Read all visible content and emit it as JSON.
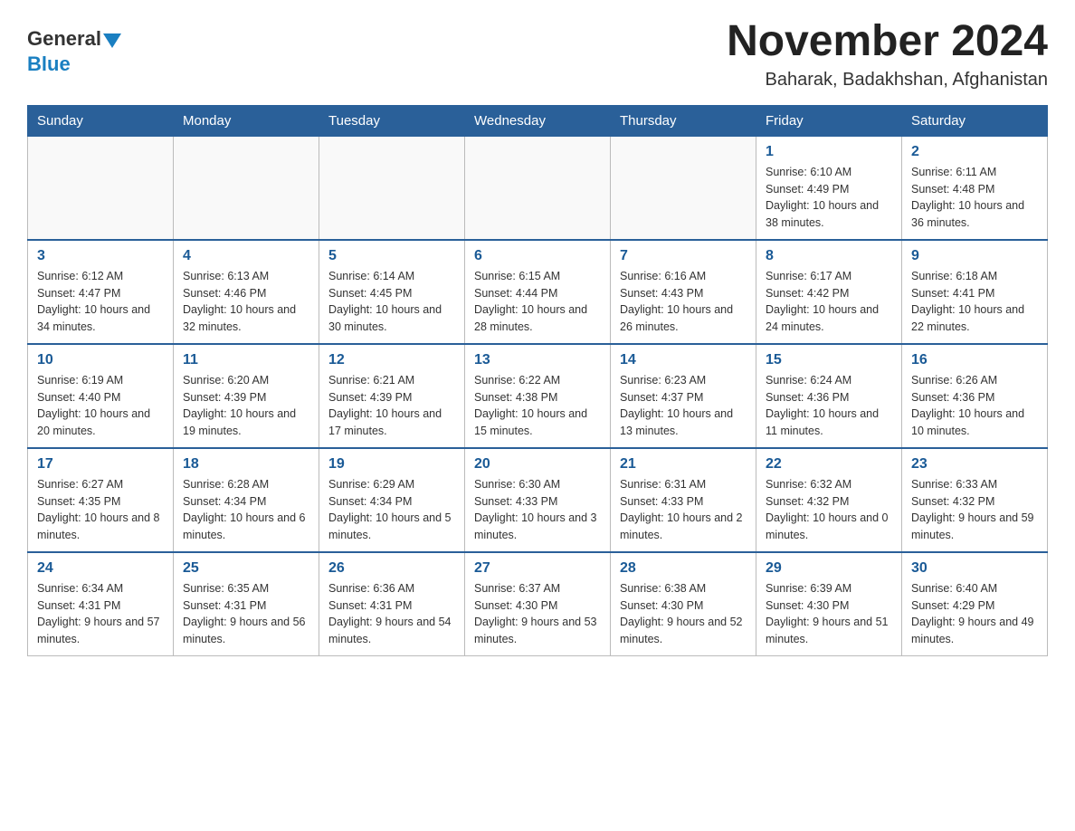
{
  "header": {
    "logo_general": "General",
    "logo_blue": "Blue",
    "month_title": "November 2024",
    "location": "Baharak, Badakhshan, Afghanistan"
  },
  "days_of_week": [
    "Sunday",
    "Monday",
    "Tuesday",
    "Wednesday",
    "Thursday",
    "Friday",
    "Saturday"
  ],
  "weeks": [
    [
      {
        "day": "",
        "sunrise": "",
        "sunset": "",
        "daylight": ""
      },
      {
        "day": "",
        "sunrise": "",
        "sunset": "",
        "daylight": ""
      },
      {
        "day": "",
        "sunrise": "",
        "sunset": "",
        "daylight": ""
      },
      {
        "day": "",
        "sunrise": "",
        "sunset": "",
        "daylight": ""
      },
      {
        "day": "",
        "sunrise": "",
        "sunset": "",
        "daylight": ""
      },
      {
        "day": "1",
        "sunrise": "Sunrise: 6:10 AM",
        "sunset": "Sunset: 4:49 PM",
        "daylight": "Daylight: 10 hours and 38 minutes."
      },
      {
        "day": "2",
        "sunrise": "Sunrise: 6:11 AM",
        "sunset": "Sunset: 4:48 PM",
        "daylight": "Daylight: 10 hours and 36 minutes."
      }
    ],
    [
      {
        "day": "3",
        "sunrise": "Sunrise: 6:12 AM",
        "sunset": "Sunset: 4:47 PM",
        "daylight": "Daylight: 10 hours and 34 minutes."
      },
      {
        "day": "4",
        "sunrise": "Sunrise: 6:13 AM",
        "sunset": "Sunset: 4:46 PM",
        "daylight": "Daylight: 10 hours and 32 minutes."
      },
      {
        "day": "5",
        "sunrise": "Sunrise: 6:14 AM",
        "sunset": "Sunset: 4:45 PM",
        "daylight": "Daylight: 10 hours and 30 minutes."
      },
      {
        "day": "6",
        "sunrise": "Sunrise: 6:15 AM",
        "sunset": "Sunset: 4:44 PM",
        "daylight": "Daylight: 10 hours and 28 minutes."
      },
      {
        "day": "7",
        "sunrise": "Sunrise: 6:16 AM",
        "sunset": "Sunset: 4:43 PM",
        "daylight": "Daylight: 10 hours and 26 minutes."
      },
      {
        "day": "8",
        "sunrise": "Sunrise: 6:17 AM",
        "sunset": "Sunset: 4:42 PM",
        "daylight": "Daylight: 10 hours and 24 minutes."
      },
      {
        "day": "9",
        "sunrise": "Sunrise: 6:18 AM",
        "sunset": "Sunset: 4:41 PM",
        "daylight": "Daylight: 10 hours and 22 minutes."
      }
    ],
    [
      {
        "day": "10",
        "sunrise": "Sunrise: 6:19 AM",
        "sunset": "Sunset: 4:40 PM",
        "daylight": "Daylight: 10 hours and 20 minutes."
      },
      {
        "day": "11",
        "sunrise": "Sunrise: 6:20 AM",
        "sunset": "Sunset: 4:39 PM",
        "daylight": "Daylight: 10 hours and 19 minutes."
      },
      {
        "day": "12",
        "sunrise": "Sunrise: 6:21 AM",
        "sunset": "Sunset: 4:39 PM",
        "daylight": "Daylight: 10 hours and 17 minutes."
      },
      {
        "day": "13",
        "sunrise": "Sunrise: 6:22 AM",
        "sunset": "Sunset: 4:38 PM",
        "daylight": "Daylight: 10 hours and 15 minutes."
      },
      {
        "day": "14",
        "sunrise": "Sunrise: 6:23 AM",
        "sunset": "Sunset: 4:37 PM",
        "daylight": "Daylight: 10 hours and 13 minutes."
      },
      {
        "day": "15",
        "sunrise": "Sunrise: 6:24 AM",
        "sunset": "Sunset: 4:36 PM",
        "daylight": "Daylight: 10 hours and 11 minutes."
      },
      {
        "day": "16",
        "sunrise": "Sunrise: 6:26 AM",
        "sunset": "Sunset: 4:36 PM",
        "daylight": "Daylight: 10 hours and 10 minutes."
      }
    ],
    [
      {
        "day": "17",
        "sunrise": "Sunrise: 6:27 AM",
        "sunset": "Sunset: 4:35 PM",
        "daylight": "Daylight: 10 hours and 8 minutes."
      },
      {
        "day": "18",
        "sunrise": "Sunrise: 6:28 AM",
        "sunset": "Sunset: 4:34 PM",
        "daylight": "Daylight: 10 hours and 6 minutes."
      },
      {
        "day": "19",
        "sunrise": "Sunrise: 6:29 AM",
        "sunset": "Sunset: 4:34 PM",
        "daylight": "Daylight: 10 hours and 5 minutes."
      },
      {
        "day": "20",
        "sunrise": "Sunrise: 6:30 AM",
        "sunset": "Sunset: 4:33 PM",
        "daylight": "Daylight: 10 hours and 3 minutes."
      },
      {
        "day": "21",
        "sunrise": "Sunrise: 6:31 AM",
        "sunset": "Sunset: 4:33 PM",
        "daylight": "Daylight: 10 hours and 2 minutes."
      },
      {
        "day": "22",
        "sunrise": "Sunrise: 6:32 AM",
        "sunset": "Sunset: 4:32 PM",
        "daylight": "Daylight: 10 hours and 0 minutes."
      },
      {
        "day": "23",
        "sunrise": "Sunrise: 6:33 AM",
        "sunset": "Sunset: 4:32 PM",
        "daylight": "Daylight: 9 hours and 59 minutes."
      }
    ],
    [
      {
        "day": "24",
        "sunrise": "Sunrise: 6:34 AM",
        "sunset": "Sunset: 4:31 PM",
        "daylight": "Daylight: 9 hours and 57 minutes."
      },
      {
        "day": "25",
        "sunrise": "Sunrise: 6:35 AM",
        "sunset": "Sunset: 4:31 PM",
        "daylight": "Daylight: 9 hours and 56 minutes."
      },
      {
        "day": "26",
        "sunrise": "Sunrise: 6:36 AM",
        "sunset": "Sunset: 4:31 PM",
        "daylight": "Daylight: 9 hours and 54 minutes."
      },
      {
        "day": "27",
        "sunrise": "Sunrise: 6:37 AM",
        "sunset": "Sunset: 4:30 PM",
        "daylight": "Daylight: 9 hours and 53 minutes."
      },
      {
        "day": "28",
        "sunrise": "Sunrise: 6:38 AM",
        "sunset": "Sunset: 4:30 PM",
        "daylight": "Daylight: 9 hours and 52 minutes."
      },
      {
        "day": "29",
        "sunrise": "Sunrise: 6:39 AM",
        "sunset": "Sunset: 4:30 PM",
        "daylight": "Daylight: 9 hours and 51 minutes."
      },
      {
        "day": "30",
        "sunrise": "Sunrise: 6:40 AM",
        "sunset": "Sunset: 4:29 PM",
        "daylight": "Daylight: 9 hours and 49 minutes."
      }
    ]
  ]
}
